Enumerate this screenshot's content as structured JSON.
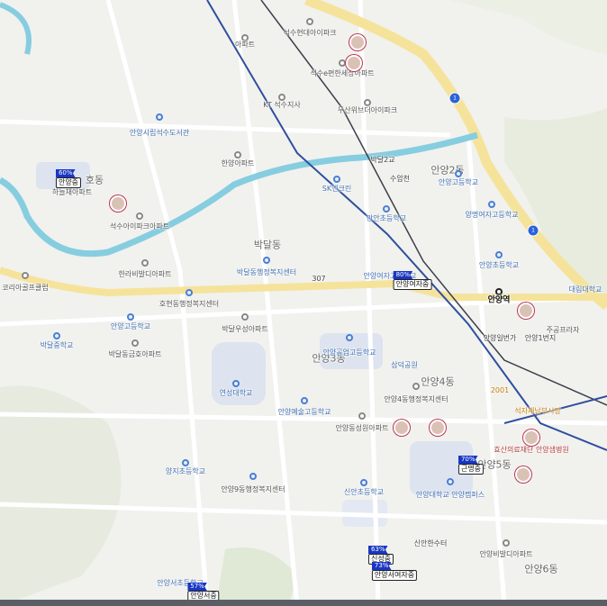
{
  "map": {
    "districts": [
      "호동",
      "박달동",
      "안양3동",
      "안양4동",
      "안양5동",
      "안양6동",
      "안양2동"
    ],
    "places": [
      {
        "text": "석수현대아이파크",
        "kind": "place"
      },
      {
        "text": "석수e편한세상아파트",
        "kind": "place"
      },
      {
        "text": "아파트",
        "kind": "place"
      },
      {
        "text": "KT 석수지사",
        "kind": "place"
      },
      {
        "text": "두산위브더아이파크",
        "kind": "place"
      },
      {
        "text": "안양시립석수도서관",
        "kind": "school"
      },
      {
        "text": "한양아파트",
        "kind": "place"
      },
      {
        "text": "석수아이파크아파트",
        "kind": "place"
      },
      {
        "text": "하늘채아파트",
        "kind": "place"
      },
      {
        "text": "한라비발디아파트",
        "kind": "place"
      },
      {
        "text": "코리아골프클럽",
        "kind": "place"
      },
      {
        "text": "박달동행정복지센터",
        "kind": "school"
      },
      {
        "text": "호현동행정복지센터",
        "kind": "place"
      },
      {
        "text": "안양고등학교",
        "kind": "school"
      },
      {
        "text": "박달중학교",
        "kind": "school"
      },
      {
        "text": "박달동금호아파트",
        "kind": "place"
      },
      {
        "text": "박달우성아파트",
        "kind": "place"
      },
      {
        "text": "SK엔크린",
        "kind": "school"
      },
      {
        "text": "만안초등학교",
        "kind": "school"
      },
      {
        "text": "안양여자고등학교",
        "kind": "school"
      },
      {
        "text": "안양고등학교",
        "kind": "school"
      },
      {
        "text": "양명여자고등학교",
        "kind": "school"
      },
      {
        "text": "안양초등학교",
        "kind": "school"
      },
      {
        "text": "안양공업고등학교",
        "kind": "school"
      },
      {
        "text": "삼덕공원",
        "kind": "school"
      },
      {
        "text": "안양4동행정복지센터",
        "kind": "place"
      },
      {
        "text": "연성대학교",
        "kind": "school"
      },
      {
        "text": "안양예술고등학교",
        "kind": "school"
      },
      {
        "text": "안양동성원아파트",
        "kind": "place"
      },
      {
        "text": "주공프라자",
        "kind": "place"
      },
      {
        "text": "효산의료재단 안양샘병원",
        "kind": "red"
      },
      {
        "text": "양지초등학교",
        "kind": "school"
      },
      {
        "text": "안양9동행정복지센터",
        "kind": "place"
      },
      {
        "text": "신안초등학교",
        "kind": "school"
      },
      {
        "text": "안양대학교 안양캠퍼스",
        "kind": "school"
      },
      {
        "text": "안양비발디아파트",
        "kind": "place"
      },
      {
        "text": "대림대학교",
        "kind": "school"
      },
      {
        "text": "2001",
        "kind": "orange"
      },
      {
        "text": "석자재남부시장",
        "kind": "orange"
      },
      {
        "text": "안양서초등학교",
        "kind": "school"
      }
    ],
    "roads": [
      "박달2교",
      "수암천",
      "307",
      "안양일번가",
      "안양1번지",
      "신안한수터"
    ],
    "station": "안양역",
    "route_shields": [
      "1",
      "1"
    ],
    "flags": [
      {
        "pct": "60%",
        "name": "안양중"
      },
      {
        "pct": "80%",
        "name": "안양여자중"
      },
      {
        "pct": "70%",
        "name": "근명중"
      },
      {
        "pct": "63%",
        "name": "신성중"
      },
      {
        "pct": "73%",
        "name": "안양서여자중"
      },
      {
        "pct": "57%",
        "name": "안양서중"
      }
    ],
    "colors": {
      "flag": "#1937c4",
      "stream": "#86cde0",
      "highway": "#f5e39b",
      "rail_blue": "#2f4f9e"
    }
  }
}
